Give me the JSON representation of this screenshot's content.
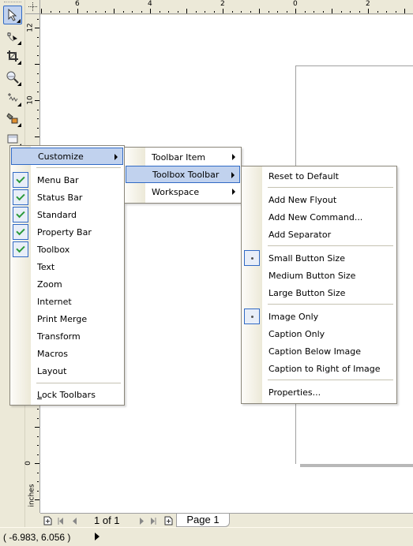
{
  "rulers": {
    "corner_icon": "ruler-origin-icon",
    "top_labels": [
      "6",
      "4",
      "2",
      "0",
      "2"
    ],
    "left_labels": [
      "12",
      "10",
      "0"
    ],
    "units": "inches"
  },
  "toolbox": {
    "tools": [
      {
        "name": "pick-tool",
        "icon": "arrow-pointer-icon",
        "active": true
      },
      {
        "name": "shape-tool",
        "icon": "node-shape-icon",
        "active": false
      },
      {
        "name": "crop-tool",
        "icon": "crop-icon",
        "active": false
      },
      {
        "name": "zoom-tool",
        "icon": "magnifier-icon",
        "active": false
      },
      {
        "name": "freehand-tool",
        "icon": "curve-icon",
        "active": false
      },
      {
        "name": "smart-fill-tool",
        "icon": "smart-fill-icon",
        "active": false
      },
      {
        "name": "rectangle-tool",
        "icon": "rectangle-icon",
        "active": false
      }
    ]
  },
  "menus": {
    "toolbars": {
      "header": {
        "label": "Customize",
        "has_submenu": true,
        "highlighted": true
      },
      "items": [
        {
          "label": "Menu Bar",
          "checked": true
        },
        {
          "label": "Status Bar",
          "checked": true
        },
        {
          "label": "Standard",
          "checked": true
        },
        {
          "label": "Property Bar",
          "checked": true
        },
        {
          "label": "Toolbox",
          "checked": true
        },
        {
          "label": "Text",
          "checked": false
        },
        {
          "label": "Zoom",
          "checked": false
        },
        {
          "label": "Internet",
          "checked": false
        },
        {
          "label": "Print Merge",
          "checked": false
        },
        {
          "label": "Transform",
          "checked": false
        },
        {
          "label": "Macros",
          "checked": false
        },
        {
          "label": "Layout",
          "checked": false
        }
      ],
      "footer": {
        "label_first": "L",
        "label_rest": "ock Toolbars"
      }
    },
    "customize": {
      "items": [
        {
          "label": "Toolbar Item",
          "has_submenu": true,
          "highlighted": false
        },
        {
          "label": "Toolbox Toolbar",
          "has_submenu": true,
          "highlighted": true
        },
        {
          "label": "Workspace",
          "has_submenu": true,
          "highlighted": false
        }
      ]
    },
    "toolbox_toolbar": {
      "groups": [
        [
          {
            "label": "Reset to Default"
          }
        ],
        [
          {
            "label": "Add New Flyout"
          },
          {
            "label": "Add New Command..."
          },
          {
            "label": "Add Separator"
          }
        ],
        [
          {
            "label": "Small Button Size",
            "selected": true
          },
          {
            "label": "Medium Button Size"
          },
          {
            "label": "Large Button Size"
          }
        ],
        [
          {
            "label": "Image Only",
            "selected": true
          },
          {
            "label": "Caption Only"
          },
          {
            "label": "Caption Below Image"
          },
          {
            "label": "Caption to Right of Image"
          }
        ],
        [
          {
            "label": "Properties..."
          }
        ]
      ]
    }
  },
  "pagebar": {
    "page_count": "1 of 1",
    "page_tab": "Page 1"
  },
  "status": {
    "coordinates": "( -6.983, 6.056  )"
  }
}
